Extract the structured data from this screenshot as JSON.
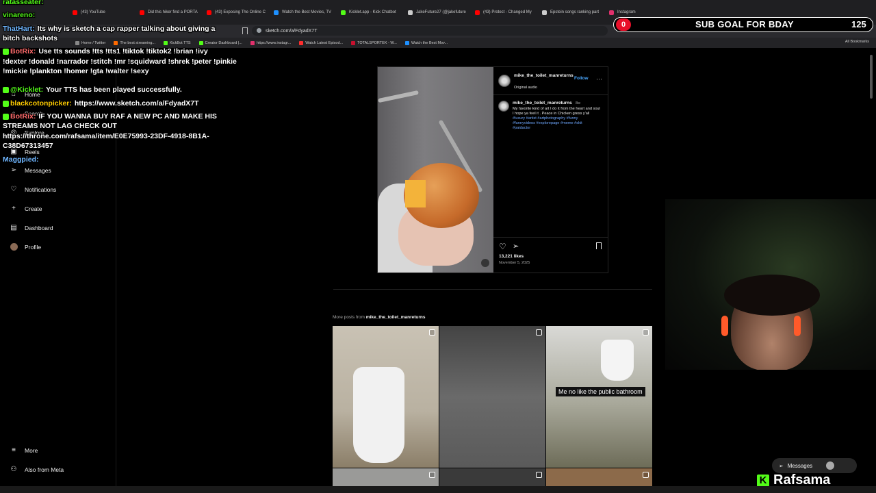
{
  "browser": {
    "tabs": [
      {
        "label": "(43) YouTube",
        "color": "#ff0000"
      },
      {
        "label": "Did this hiker find a PORTA",
        "color": "#ff0000"
      },
      {
        "label": "(43) Exposing The Online C",
        "color": "#ff0000"
      },
      {
        "label": "Watch the Best Movies, TV",
        "color": "#1e90ff"
      },
      {
        "label": "Kicklet.app - Kick Chatbot",
        "color": "#53fc18"
      },
      {
        "label": "JakeFuture27 (@jakefuture",
        "color": "#cccccc"
      },
      {
        "label": "(43) Protect - Changed My",
        "color": "#ff0000"
      },
      {
        "label": "Epstein songs ranking part",
        "color": "#cccccc"
      },
      {
        "label": "Instagram",
        "color": "#e1306c"
      }
    ],
    "url": "sketch.com/a/FdyadX7T",
    "bookmarks": [
      {
        "label": "Home / Twitter",
        "color": "#888888"
      },
      {
        "label": "The best streaming...",
        "color": "#ff6a00"
      },
      {
        "label": "KickBot TTS",
        "color": "#53fc18"
      },
      {
        "label": "Creator Dashboard |...",
        "color": "#53fc18"
      },
      {
        "label": "https://www.instagr...",
        "color": "#e1306c"
      },
      {
        "label": "Watch Latest Episod...",
        "color": "#ff2d2d"
      },
      {
        "label": "TOTALSPORTEK - W...",
        "color": "#c8102e"
      },
      {
        "label": "Watch the Best Mov...",
        "color": "#1e90ff"
      }
    ],
    "all_bookmarks": "All Bookmarks"
  },
  "sidebar": {
    "items": [
      {
        "label": "Home",
        "icon": "home-icon"
      },
      {
        "label": "Search",
        "icon": "search-icon"
      },
      {
        "label": "Explore",
        "icon": "compass-icon"
      },
      {
        "label": "Reels",
        "icon": "reels-icon"
      },
      {
        "label": "Messages",
        "icon": "messages-icon"
      },
      {
        "label": "Notifications",
        "icon": "heart-icon"
      },
      {
        "label": "Create",
        "icon": "plus-icon"
      },
      {
        "label": "Dashboard",
        "icon": "dashboard-icon"
      },
      {
        "label": "Profile",
        "icon": "profile-icon"
      }
    ],
    "more": "More",
    "also_from_meta": "Also from Meta"
  },
  "post": {
    "username": "mike_the_toilet_manreturns",
    "follow": "Follow",
    "audio": "Original audio",
    "caption_user": "mike_the_toilet_manreturns",
    "caption_age": "8w",
    "caption_text": "My favorite kind of art I do it from the heart and soul I hope ya feel it . Peace in Chicken gress y'all",
    "hashtags": "#luxury #artist #artphotography #funny #funnyvideos #explorepage #meme #skit #paidactor",
    "likes": "13,221 likes",
    "date": "November 5, 2025"
  },
  "more_posts": {
    "prefix": "More posts from",
    "username": "mike_the_toilet_manreturns",
    "tile_caption": "Me no like the public bathroom"
  },
  "stream": {
    "chat": [
      {
        "user": "ratasseater:",
        "user_color": "#53fc18",
        "text": ""
      },
      {
        "user": "vinareno:",
        "user_color": "#53fc18",
        "text": ""
      },
      {
        "user": "ThatHart:",
        "user_color": "#6fb6ff",
        "text": "Its why is sketch a cap rapper talking about giving a"
      },
      {
        "user": "",
        "user_color": "#ffffff",
        "text": "bitch backshots"
      },
      {
        "user": "BotRix:",
        "user_color": "#ff6b6b",
        "text": "Use tts sounds !tts !tts1 !tiktok !tiktok2 !brian !ivy"
      },
      {
        "user": "",
        "user_color": "#ffffff",
        "text": "!dexter !donald !narrador !stitch !mr !squidward !shrek !peter !pinkie"
      },
      {
        "user": "",
        "user_color": "#ffffff",
        "text": "!mickie !plankton !homer !gta !walter !sexy"
      },
      {
        "user": "@Kicklet:",
        "user_color": "#53fc18",
        "text": "Your TTS has been played successfully."
      },
      {
        "user": "blackcotonpicker:",
        "user_color": "#ffcc00",
        "text": "https://www.sketch.com/a/FdyadX7T"
      },
      {
        "user": "BotRix:",
        "user_color": "#ff6b6b",
        "text": "IF YOU WANNA BUY RAF A NEW PC AND MAKE HIS"
      },
      {
        "user": "",
        "user_color": "#ffffff",
        "text": "STREAMS NOT LAG CHECK OUT"
      },
      {
        "user": "",
        "user_color": "#ffffff",
        "text": "https://throne.com/rafsama/item/E0E75993-23DF-4918-8B1A-"
      },
      {
        "user": "",
        "user_color": "#ffffff",
        "text": "C38D67313457"
      },
      {
        "user": "Maggpied:",
        "user_color": "#6fb6ff",
        "text": ""
      }
    ],
    "subgoal_current": "0",
    "subgoal_title": "SUB GOAL FOR BDAY",
    "subgoal_target": "125",
    "brand": "Rafsama",
    "brand_letter": "K",
    "messages": "Messages"
  },
  "colors": {
    "accent": "#4aa8ff",
    "kick_green": "#53fc18",
    "subgoal_red": "#e8102a"
  }
}
